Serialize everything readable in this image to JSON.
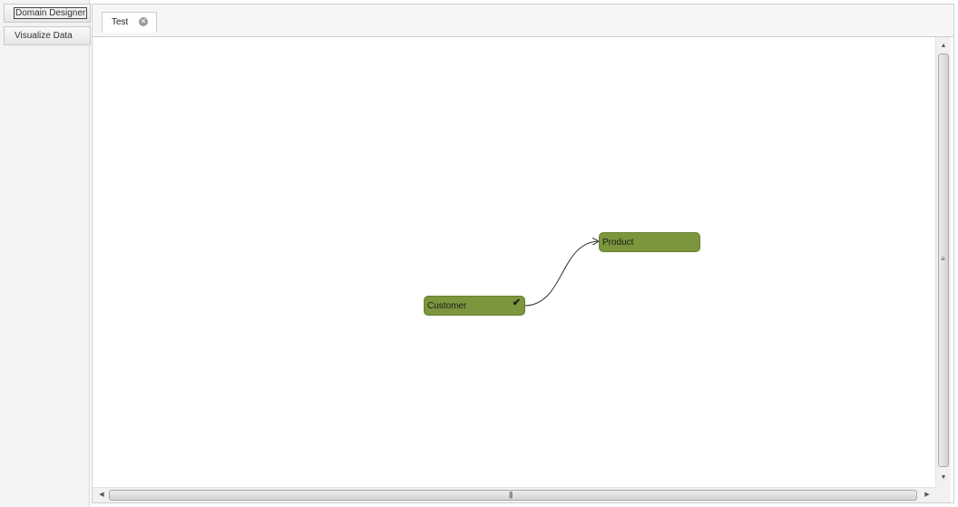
{
  "sidebar": {
    "items": [
      {
        "label": "Domain Designer"
      },
      {
        "label": "Visualize Data"
      }
    ]
  },
  "tabs": [
    {
      "label": "Test",
      "close_icon": "close-circle-icon"
    }
  ],
  "diagram": {
    "nodes": [
      {
        "label": "Customer",
        "color": "#7b963c",
        "selected_icon": "checkmark-icon"
      },
      {
        "label": "Product",
        "color": "#7b963c"
      }
    ],
    "edges": [
      {
        "from": "Customer",
        "to": "Product"
      }
    ]
  },
  "scrollbars": {
    "vertical": {
      "up_icon": "arrow-up-icon",
      "down_icon": "arrow-down-icon"
    },
    "horizontal": {
      "left_icon": "arrow-left-icon",
      "right_icon": "arrow-right-icon"
    }
  }
}
